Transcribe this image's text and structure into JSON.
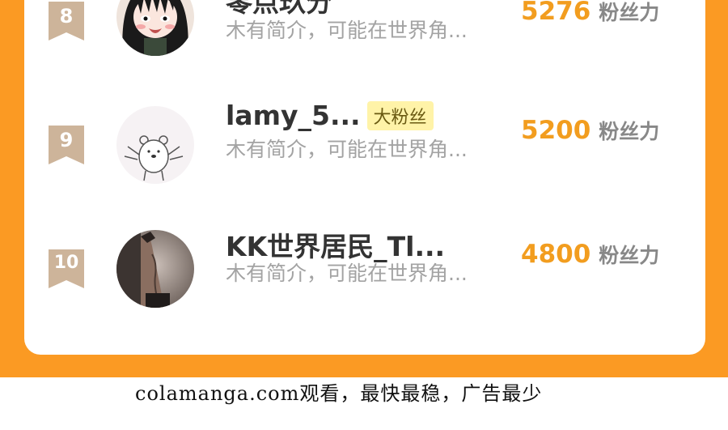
{
  "rows": [
    {
      "rank": "8",
      "name": "零点玖分",
      "tag": "",
      "bio": "木有简介，可能在世界角...",
      "score": "5276",
      "unit": "粉丝力"
    },
    {
      "rank": "9",
      "name": "lamy_5...",
      "tag": "大粉丝",
      "bio": "木有简介，可能在世界角...",
      "score": "5200",
      "unit": "粉丝力"
    },
    {
      "rank": "10",
      "name": "KK世界居民_Tl...",
      "tag": "",
      "bio": "木有简介，可能在世界角...",
      "score": "4800",
      "unit": "粉丝力"
    }
  ],
  "footer": {
    "text": "colamanga.com观看，最快最稳，广告最少"
  },
  "colors": {
    "frame": "#fb9a23",
    "score": "#f29d1f",
    "badge": "#cdb49a",
    "tag_bg": "#fff3a8"
  },
  "icons": {
    "rank_badge": "ribbon-bookmark-icon",
    "avatar_8": "anime-girl-avatar",
    "avatar_9": "bear-doodle-avatar",
    "avatar_10": "photo-avatar"
  }
}
